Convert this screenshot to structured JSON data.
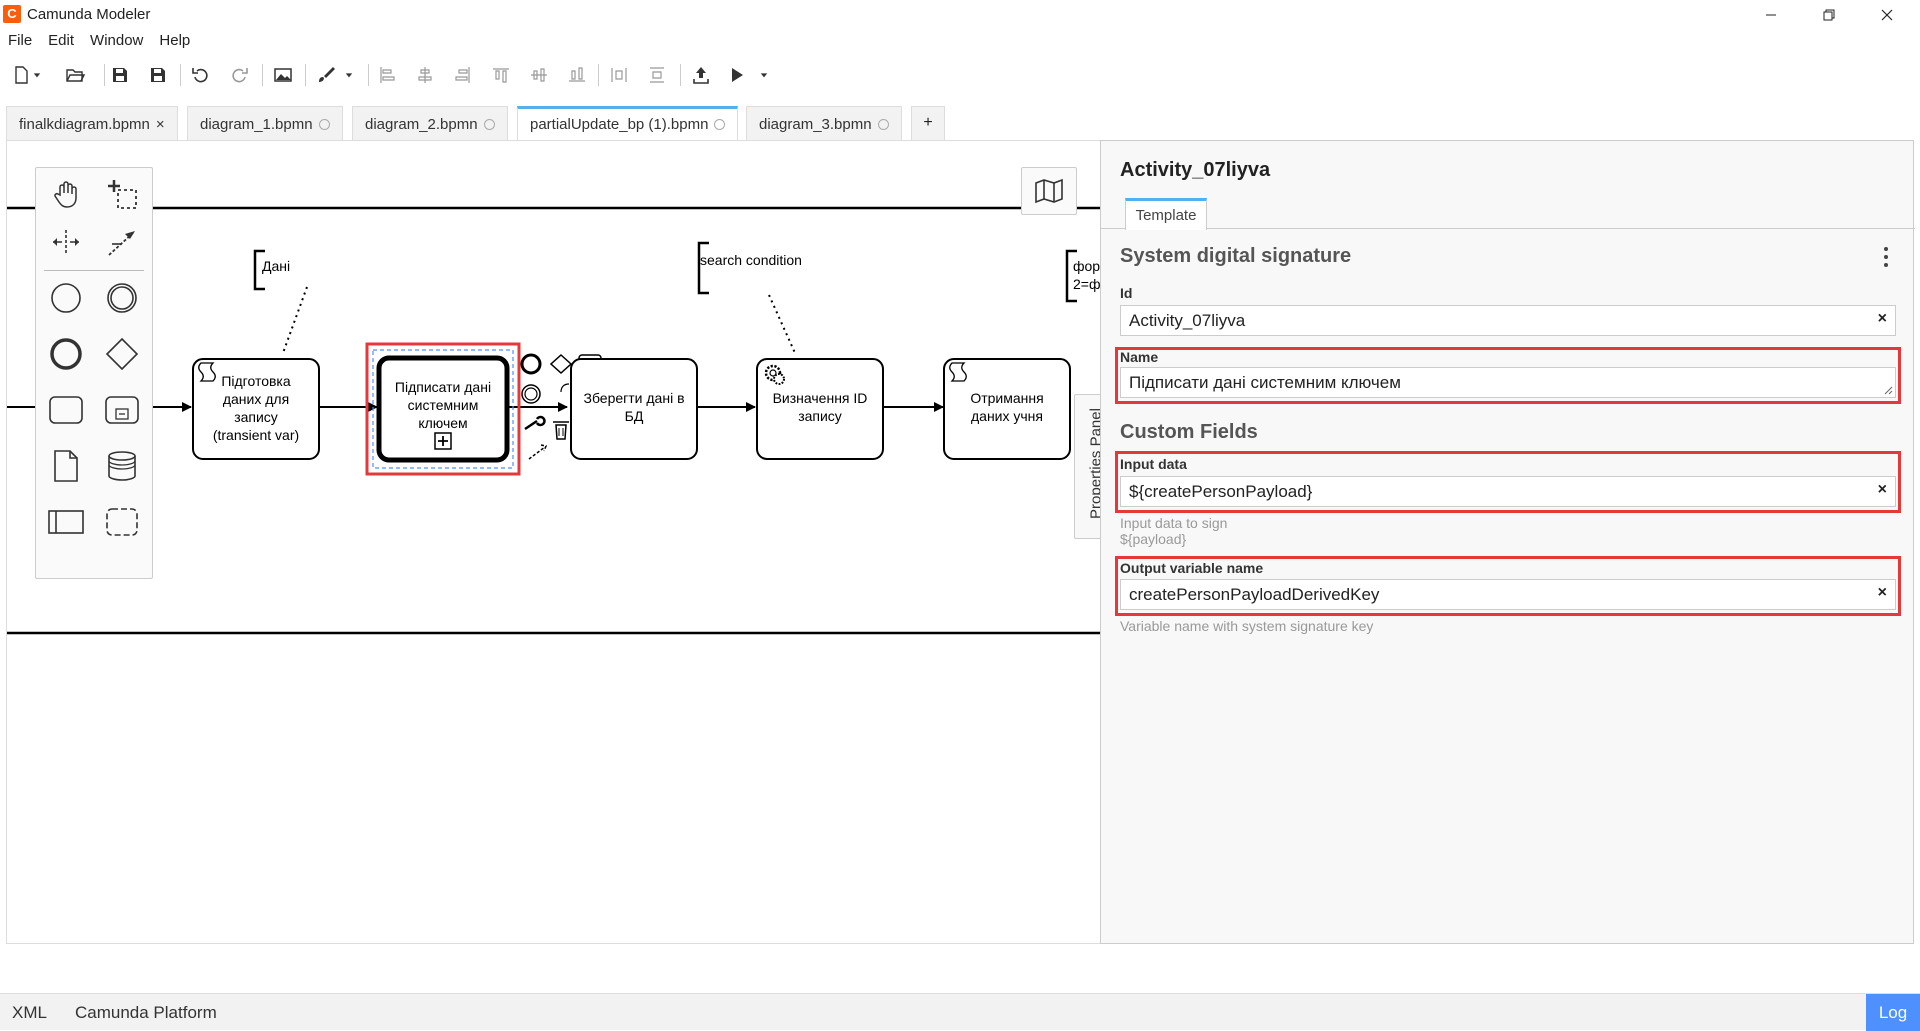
{
  "app": {
    "title": "Camunda Modeler",
    "logo": "C"
  },
  "menu": [
    "File",
    "Edit",
    "Window",
    "Help"
  ],
  "tabs": [
    {
      "label": "finalkdiagram.bpmn",
      "close": "×"
    },
    {
      "label": "diagram_1.bpmn"
    },
    {
      "label": "diagram_2.bpmn"
    },
    {
      "label": "partialUpdate_bp (1).bpmn",
      "active": true
    },
    {
      "label": "diagram_3.bpmn"
    }
  ],
  "tab_add": "+",
  "diagram": {
    "tasks": {
      "t1": [
        "Підготовка",
        "даних для",
        "запису",
        "(transient var)"
      ],
      "t2": [
        "Підписати дані",
        "системним",
        "ключем"
      ],
      "t3": [
        "Зберегти дані в",
        "БД"
      ],
      "t4": [
        "Визначення ID",
        "запису"
      ],
      "t5": [
        "Отримання",
        "даних учня"
      ]
    },
    "annotations": {
      "a1": "Дані",
      "a2": "search condition",
      "a3_line1": "фор",
      "a3_line2": "2=ф"
    }
  },
  "side_tab": "Properties Panel",
  "panel": {
    "title": "Activity_07liyva",
    "tab": "Template",
    "group1": "System digital signature",
    "id_label": "Id",
    "id_value": "Activity_07liyva",
    "name_label": "Name",
    "name_value": "Підписати дані системним ключем",
    "group2": "Custom Fields",
    "input_label": "Input data",
    "input_value": "${createPersonPayload}",
    "input_desc_1": "Input data to sign",
    "input_desc_2": "${payload}",
    "output_label": "Output variable name",
    "output_value": "createPersonPayloadDerivedKey",
    "output_desc": "Variable name with system signature key",
    "clear": "×"
  },
  "status": {
    "xml": "XML",
    "platform": "Camunda Platform",
    "log": "Log"
  },
  "colors": {
    "accent": "#52b0ec",
    "highlight": "#e5383b",
    "log": "#4d90fe",
    "logo": "#fc5d0d"
  }
}
